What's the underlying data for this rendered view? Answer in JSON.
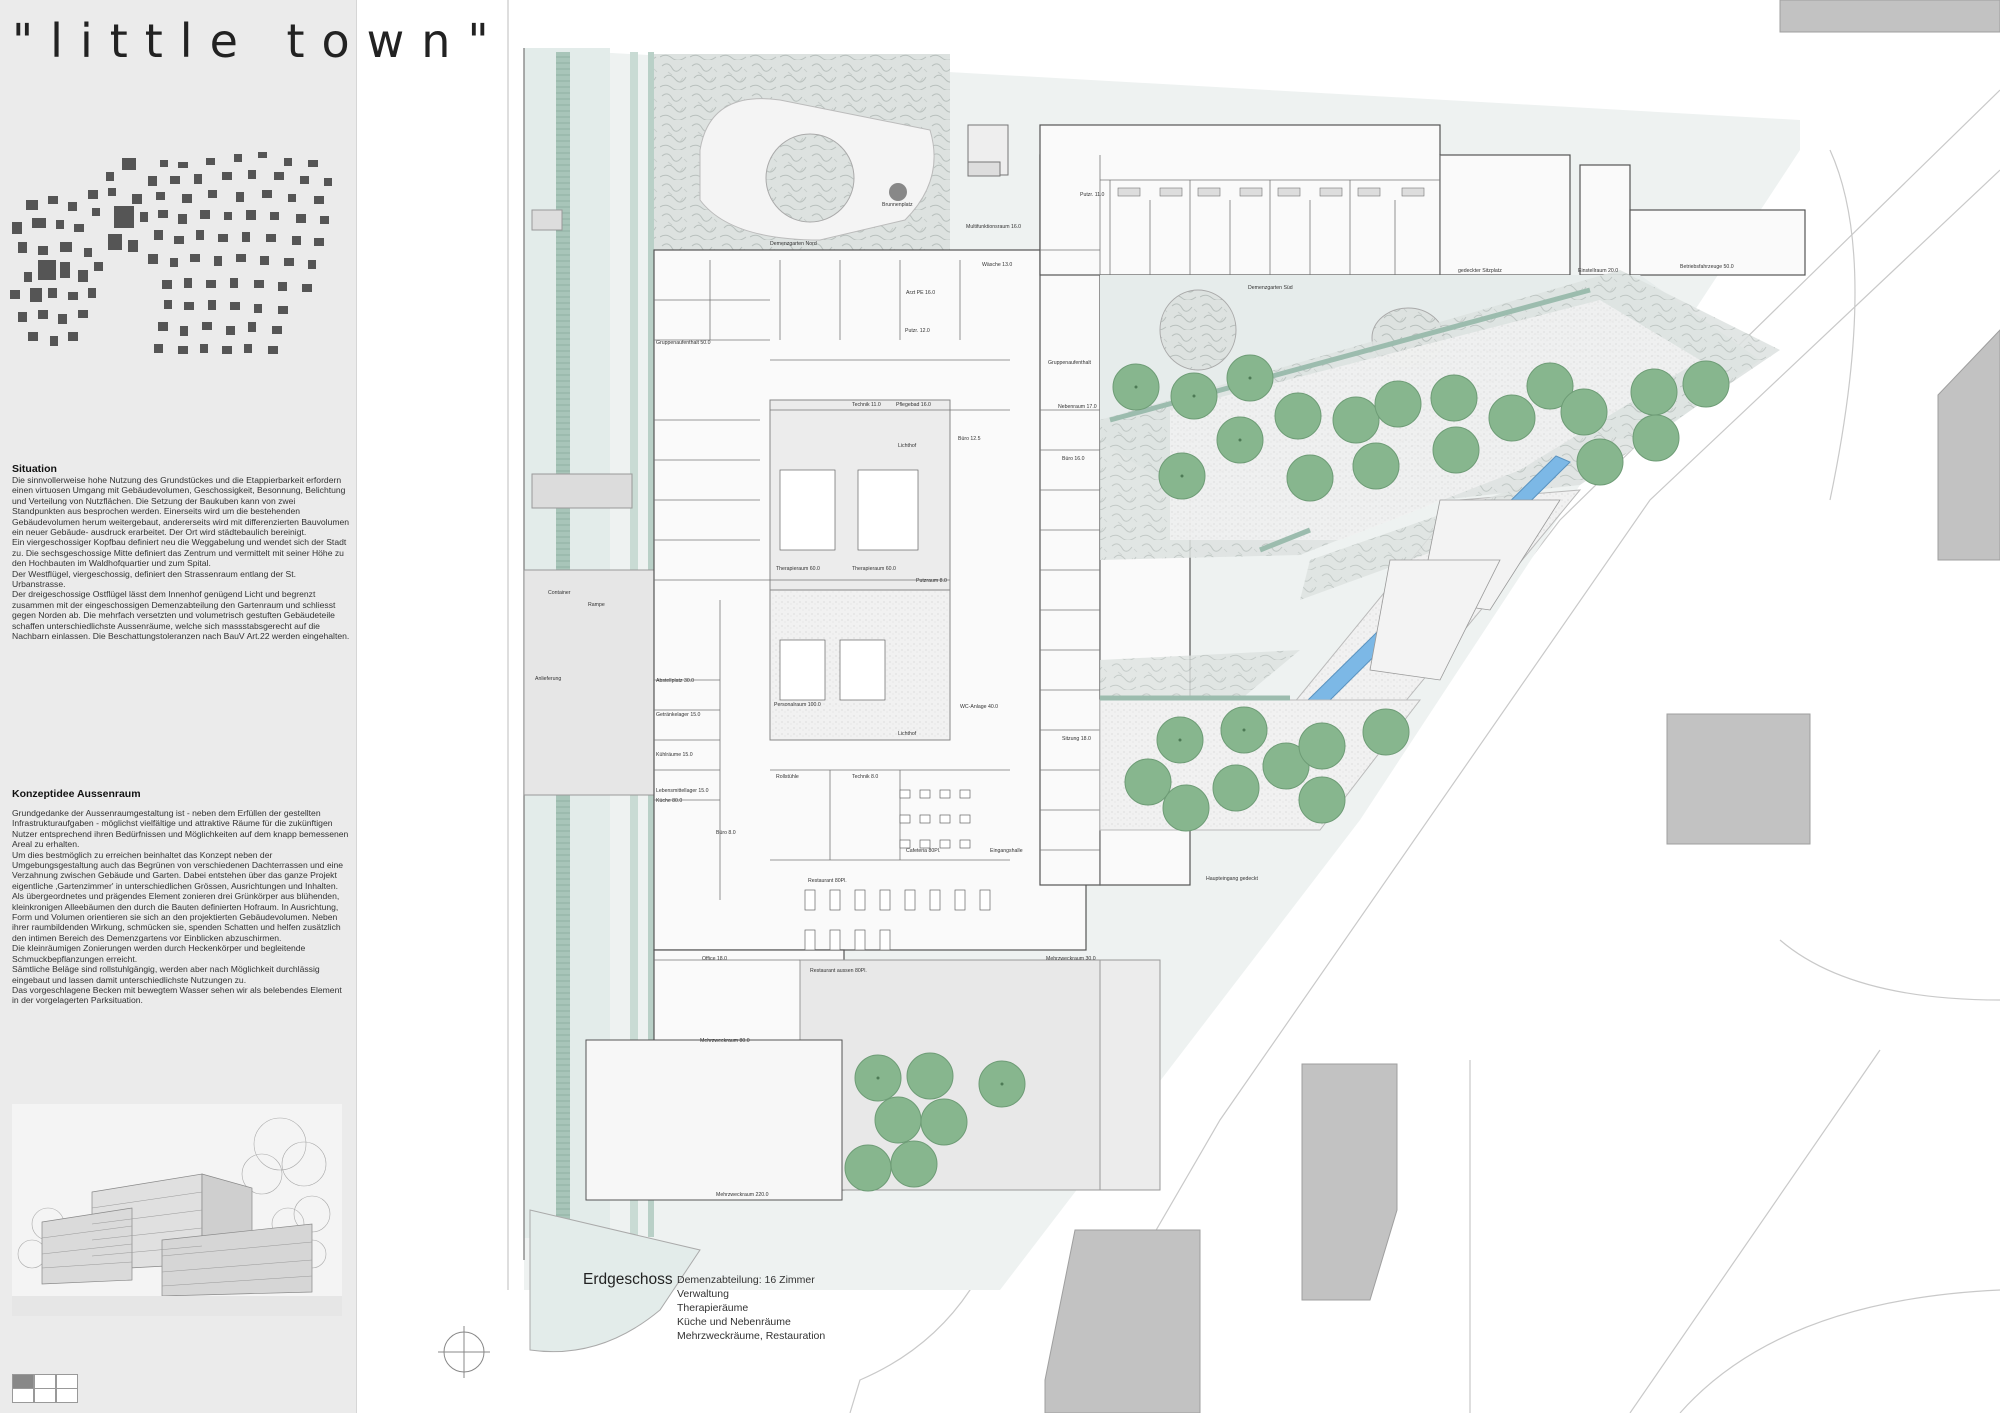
{
  "title": "\"little town\"",
  "situation": {
    "heading": "Situation",
    "paragraphs": [
      "Die sinnvollerweise hohe Nutzung des Grundstückes und die Etappierbarkeit erfordern einen virtuosen Umgang mit Gebäudevolumen, Geschossigkeit, Besonnung, Belichtung und Verteilung von Nutzflächen. Die Setzung der Baukuben kann von zwei Standpunkten aus besprochen werden. Einerseits wird um die bestehenden Gebäudevolumen herum weitergebaut, andererseits wird mit differenzierten Bauvolumen ein neuer Gebäude- ausdruck erarbeitet. Der Ort wird städtebaulich bereinigt.",
      "Ein viergeschossiger Kopfbau definiert neu die Weggabelung und wendet sich der Stadt zu. Die sechsgeschossige Mitte definiert das Zentrum und vermittelt mit seiner Höhe zu den Hochbauten im Waldhofquartier und zum Spital.",
      "Der Westflügel, viergeschossig, definiert den Strassenraum entlang der St. Urbanstrasse.",
      "Der dreigeschossige Ostflügel lässt dem Innenhof genügend Licht und begrenzt zusammen mit der eingeschossigen Demenzabteilung den Gartenraum und schliesst gegen Norden ab. Die mehrfach versetzten und volumetrisch gestuften Gebäudeteile schaffen unterschiedlichste Aussenräume, welche sich massstabsgerecht auf die Nachbarn einlassen. Die Beschattungstoleranzen nach BauV Art.22 werden eingehalten."
    ]
  },
  "konzept": {
    "heading": "Konzeptidee Aussenraum",
    "paragraphs": [
      "Grundgedanke der Aussenraumgestaltung ist - neben dem Erfüllen der gestellten Infrastrukturaufgaben - möglichst vielfältige und attraktive Räume für die zukünftigen Nutzer entsprechend ihren Bedürfnissen und Möglichkeiten auf dem knapp bemessenen Areal zu erhalten.",
      "Um dies bestmöglich zu erreichen beinhaltet das Konzept neben der Umgebungsgestaltung auch das Begrünen von verschiedenen Dachterrassen und eine Verzahnung zwischen Gebäude und Garten. Dabei entstehen über das ganze Projekt eigentliche ‚Gartenzimmer' in unterschiedlichen Grössen, Ausrichtungen und Inhalten.",
      "Als übergeordnetes und prägendes Element zonieren drei Grünkörper aus blühenden, kleinkronigen Alleebäumen den durch die Bauten definierten Hofraum. In Ausrichtung, Form und Volumen orientieren sie sich an den projektierten Gebäudevolumen. Neben ihrer raumbildenden Wirkung, schmücken sie, spenden Schatten und helfen zusätzlich den intimen Bereich des Demenzgartens vor Einblicken abzuschirmen.",
      "Die kleinräumigen Zonierungen werden durch Heckenkörper und begleitende Schmuckbepflanzungen erreicht.",
      "Sämtliche Beläge sind rollstuhlgängig, werden aber nach Möglichkeit durchlässig eingebaut und lassen damit unterschiedlichste Nutzungen zu.",
      "Das vorgeschlagene Becken mit bewegtem Wasser sehen wir als belebendes Element in der vorgelagerten Parksituation."
    ]
  },
  "plan_labels": {
    "floor": "Erdgeschoss",
    "demenz": "Demenzabteilung: 16 Zimmer",
    "verwaltung": "Verwaltung",
    "therapie": "Therapieräume",
    "kueche": "Küche und Nebenräume",
    "mehrzweck": "Mehrzweckräume, Restauration"
  },
  "rooms": [
    "Demenzgarten Nord",
    "Brunnenplatz",
    "Demenzgarten Süd",
    "Multifunktionsraum 16.0",
    "gedeckter Sitzplatz",
    "Einstellraum 20.0",
    "Betriebsfahrzeuge 50.0",
    "Gruppenaufenthalt 50.0",
    "Gruppenaufenthalt",
    "Nebenraum 17.0",
    "Büro 12.5",
    "Büro 16.0",
    "Sitzung 18.0",
    "Therapieraum 60.0",
    "Therapieraum 60.0",
    "Personalraum 100.0",
    "WC-Anlage 40.0",
    "Lichthof",
    "Lichthof",
    "Cafeteria 80Pl.",
    "Eingangshalle",
    "Restaurant 80Pl.",
    "Restaurant aussen 80Pl.",
    "Mehrzweckraum 80.0",
    "Mehrzweckraum 220.0",
    "Office 18.0",
    "Mehrzweckraum 30.0",
    "Anlieferung",
    "Container",
    "Rampe",
    "Abstellplatz 30.0",
    "Getränkelager 15.0",
    "Kühlräume 15.0",
    "Lebensmittellager 15.0",
    "Küche 80.0",
    "Büro 8.0",
    "Rollstühle",
    "Technik 8.0",
    "Haupteingang gedeckt",
    "Putzraum 8.0",
    "Technik 11.0",
    "Pflegebad 16.0",
    "Arzt PE 16.0",
    "Putzr. 11.0",
    "Wäsche 13.0",
    "Putzr. 12.0"
  ],
  "colors": {
    "panel": "#ebebeb",
    "tree": "#87b68e",
    "tree_edge": "#6e9c76",
    "water": "#7cb8e6",
    "hedge": "#9cbcae",
    "grass": "#e3ecea",
    "bldg": "#c2c2c2"
  }
}
